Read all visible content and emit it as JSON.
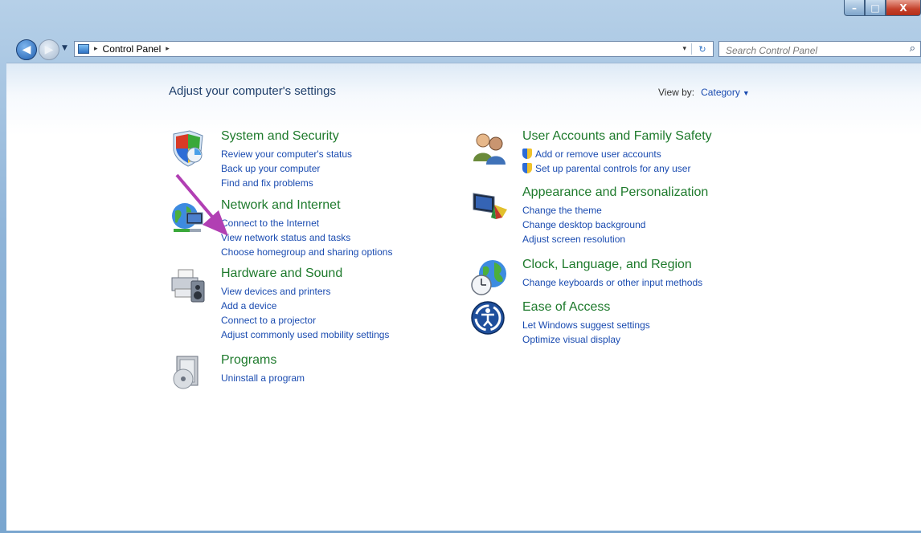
{
  "titlebar": {
    "min_label": "–",
    "max_label": "□",
    "close_label": "X"
  },
  "navigation": {
    "back_icon": "back-arrow-icon",
    "forward_icon": "forward-arrow-icon",
    "recent_icon": "chevron-down-icon"
  },
  "address": {
    "separator": "▸",
    "crumb": "Control Panel",
    "trailing": "▸",
    "dropdown": "▾",
    "refresh": "↻"
  },
  "search": {
    "placeholder": "Search Control Panel"
  },
  "page": {
    "title": "Adjust your computer's settings"
  },
  "view_by": {
    "label": "View by:",
    "value": "Category"
  },
  "categories": [
    {
      "title": "System and Security",
      "icon": "shield-icon",
      "links": [
        "Review your computer's status",
        "Back up your computer",
        "Find and fix problems"
      ]
    },
    {
      "title": "Network and Internet",
      "icon": "globe-network-icon",
      "links": [
        "Connect to the Internet",
        "View network status and tasks",
        "Choose homegroup and sharing options"
      ]
    },
    {
      "title": "Hardware and Sound",
      "icon": "printer-speaker-icon",
      "links": [
        "View devices and printers",
        "Add a device",
        "Connect to a projector",
        "Adjust commonly used mobility settings"
      ]
    },
    {
      "title": "Programs",
      "icon": "programs-icon",
      "links": [
        "Uninstall a program"
      ]
    },
    {
      "title": "User Accounts and Family Safety",
      "icon": "users-icon",
      "links": [
        "Add or remove user accounts",
        "Set up parental controls for any user"
      ]
    },
    {
      "title": "Appearance and Personalization",
      "icon": "monitor-palette-icon",
      "links": [
        "Change the theme",
        "Change desktop background",
        "Adjust screen resolution"
      ]
    },
    {
      "title": "Clock, Language, and Region",
      "icon": "globe-clock-icon",
      "links": [
        "Change keyboards or other input methods"
      ]
    },
    {
      "title": "Ease of Access",
      "icon": "ease-of-access-icon",
      "links": [
        "Let Windows suggest settings",
        "Optimize visual display"
      ]
    }
  ],
  "annotation": {
    "color": "#b13fb3"
  }
}
